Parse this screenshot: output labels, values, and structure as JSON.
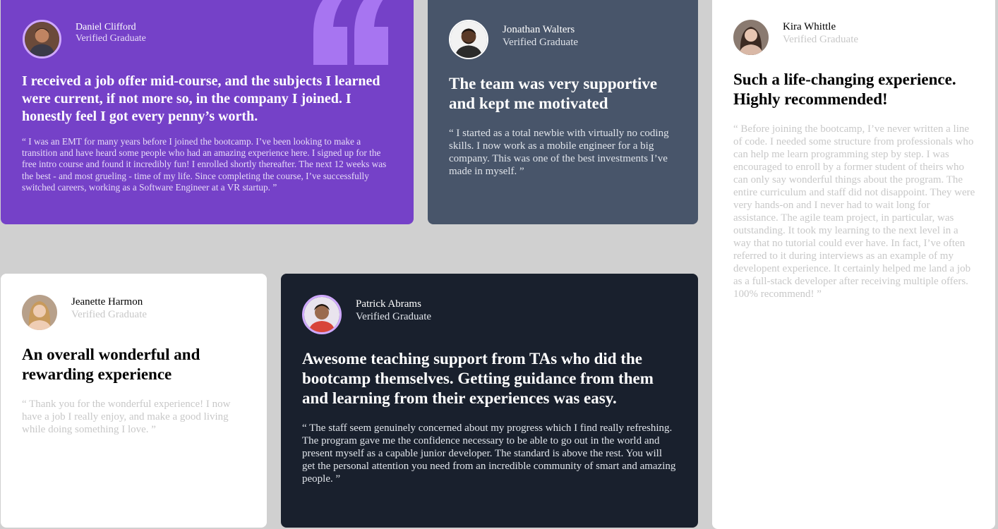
{
  "colors": {
    "background": "#d0d0d0",
    "purple_card": "#7541c8",
    "grey_blue_card": "#48556a",
    "dark_card": "#19202d",
    "white_card": "#ffffff",
    "avatar_ring": "#cfa9ff"
  },
  "testimonials": [
    {
      "name": "Daniel Clifford",
      "role": "Verified Graduate",
      "headline": "I received a job offer mid-course, and the subjects I learned were current, if not more so, in the company I joined. I honestly feel I got every penny’s worth.",
      "quote": "“ I was an EMT for many years before I joined the bootcamp. I’ve been looking to make a transition and have heard some people who had an amazing experience here. I signed up for the free intro course and found it incredibly fun! I enrolled shortly thereafter. The next 12 weeks was the best - and most grueling - time of my life. Since completing the course, I’ve successfully switched careers, working as a Software Engineer at a VR startup. ”",
      "avatar_icon": "avatar-daniel"
    },
    {
      "name": "Jonathan Walters",
      "role": "Verified Graduate",
      "headline": "The team was very supportive and kept me motivated",
      "quote": "“ I started as a total newbie with virtually no coding skills. I now work as a mobile engineer for a big company. This was one of the best investments I’ve made in myself. ”",
      "avatar_icon": "avatar-jonathan"
    },
    {
      "name": "Kira Whittle",
      "role": "Verified Graduate",
      "headline": "Such a life-changing experience. Highly recommended!",
      "quote": "“ Before joining the bootcamp, I’ve never written a line of code. I needed some structure from professionals who can help me learn programming step by step. I was encouraged to enroll by a former student of theirs who can only say wonderful things about the program. The entire curriculum and staff did not disappoint. They were very hands-on and I never had to wait long for assistance. The agile team project, in particular, was outstanding. It took my learning to the next level in a way that no tutorial could ever have. In fact, I’ve often referred to it during interviews as an example of my developent experience. It certainly helped me land a job as a full-stack developer after receiving multiple offers. 100% recommend! ”",
      "avatar_icon": "avatar-kira"
    },
    {
      "name": "Jeanette Harmon",
      "role": "Verified Graduate",
      "headline": "An overall wonderful and rewarding experience",
      "quote": "“ Thank you for the wonderful experience! I now have a job I really enjoy, and make a good living while doing something I love. ”",
      "avatar_icon": "avatar-jeanette"
    },
    {
      "name": "Patrick Abrams",
      "role": "Verified Graduate",
      "headline": "Awesome teaching support from TAs who did the bootcamp themselves. Getting guidance from them and learning from their experiences was easy.",
      "quote": "“ The staff seem genuinely concerned about my progress which I find really refreshing. The program gave me the confidence necessary to be able to go out in the world and present myself as a capable junior developer. The standard is above the rest. You will get the personal attention you need from an incredible community of smart and amazing people. ”",
      "avatar_icon": "avatar-patrick"
    }
  ]
}
